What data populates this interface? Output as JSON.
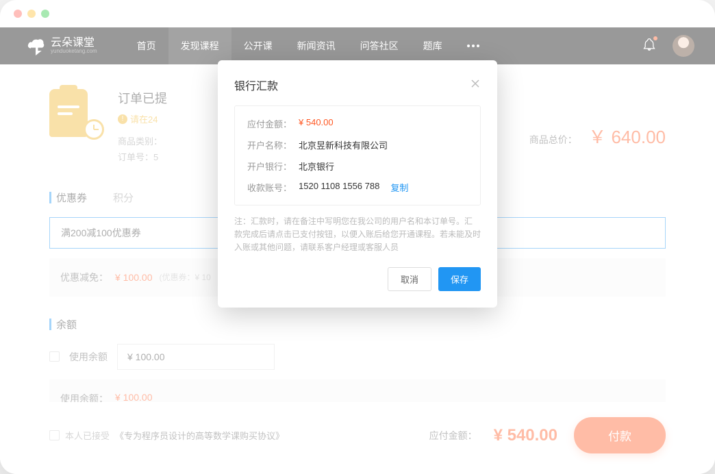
{
  "logo": {
    "main": "云朵课堂",
    "sub": "yunduoketang.com"
  },
  "nav": {
    "items": [
      "首页",
      "发现课程",
      "公开课",
      "新闻资讯",
      "问答社区",
      "题库"
    ],
    "active_index": 1
  },
  "order": {
    "title": "订单已提",
    "warning": "请在24",
    "category_label": "商品类别：",
    "number_label": "订单号：5",
    "total_label": "商品总价：",
    "total_amount": "￥ 640.00"
  },
  "coupon": {
    "tabs": [
      "优惠券",
      "积分"
    ],
    "selected": "满200减100优惠券",
    "discount_label": "优惠减免：",
    "discount_amount": "¥ 100.00",
    "discount_note": "(优惠券：¥ 10"
  },
  "balance": {
    "title": "余额",
    "use_label": "使用余额",
    "input_value": "¥ 100.00",
    "used_label": "使用余额：",
    "used_amount": "¥ 100.00"
  },
  "footer": {
    "agree_prefix": "本人已接受",
    "agree_link": "《专为程序员设计的高等数学课购买协议》",
    "final_label": "应付金额：",
    "final_amount": "¥ 540.00",
    "pay_button": "付款"
  },
  "modal": {
    "title": "银行汇款",
    "rows": {
      "amount_label": "应付金额：",
      "amount_value": "¥ 540.00",
      "name_label": "开户名称：",
      "name_value": "北京昱新科技有限公司",
      "bank_label": "开户银行：",
      "bank_value": "北京银行",
      "account_label": "收款账号：",
      "account_value": "1520 1108 1556 788",
      "copy": "复制"
    },
    "note_label": "注：",
    "note_text": "汇款时，请在备注中写明您在我公司的用户名和本订单号。汇款完成后请点击已支付按钮，以便入账后给您开通课程。若未能及时入账或其他问题，请联系客户经理或客服人员",
    "cancel": "取消",
    "save": "保存"
  }
}
